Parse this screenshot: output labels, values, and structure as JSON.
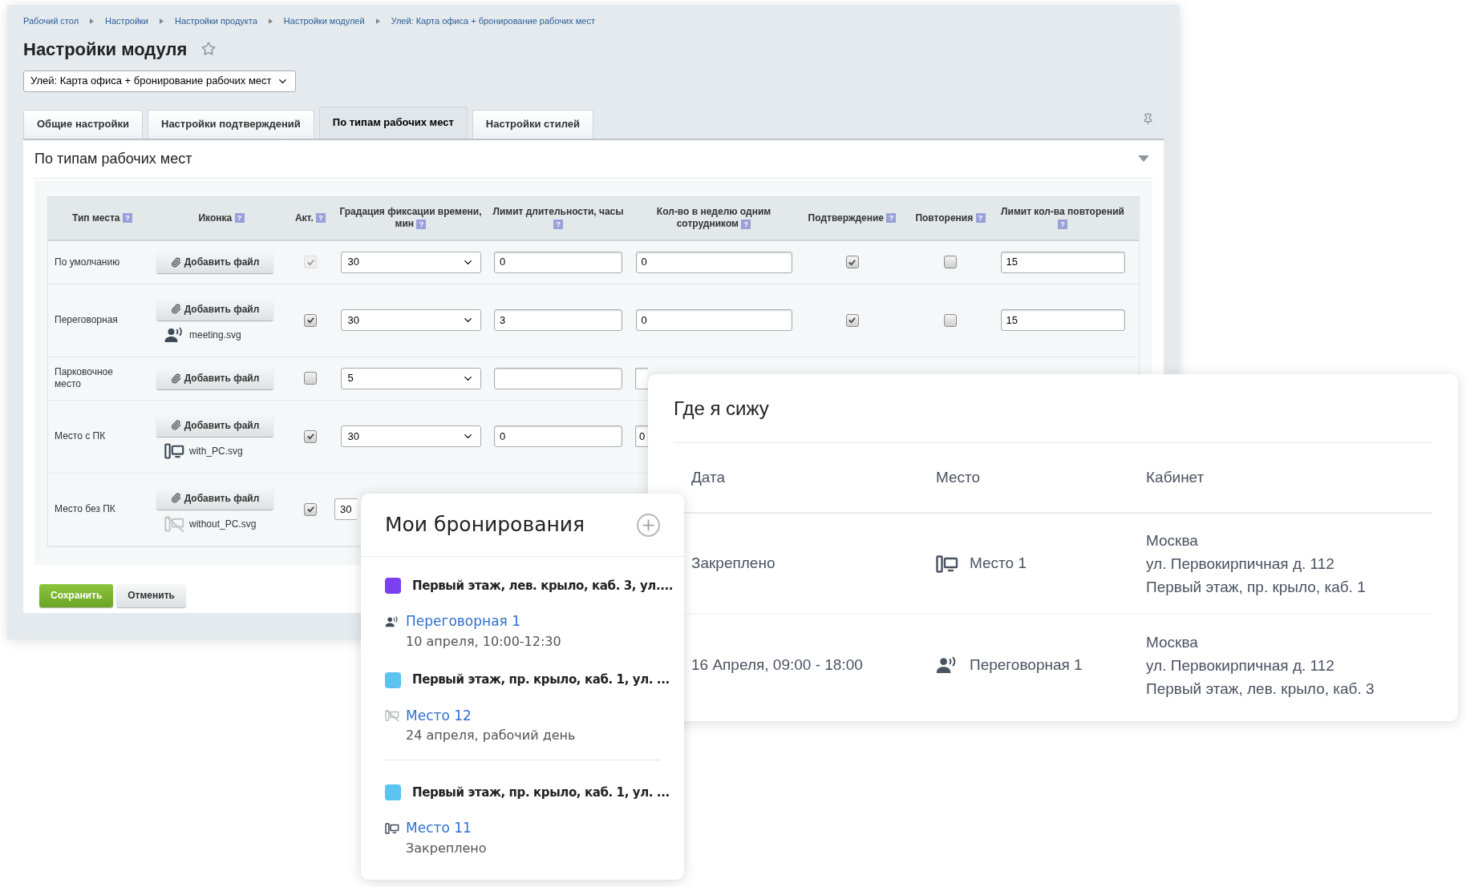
{
  "admin": {
    "breadcrumbs": [
      "Рабочий стол",
      "Настройки",
      "Настройки продукта",
      "Настройки модулей",
      "Улей: Карта офиса + бронирование рабочих мест"
    ],
    "title": "Настройки модуля",
    "module_select": {
      "value": "Улей: Карта офиса + бронирование рабочих мест"
    },
    "tabs": [
      {
        "label": "Общие настройки",
        "selected": false
      },
      {
        "label": "Настройки подтверждений",
        "selected": false
      },
      {
        "label": "По типам рабочих мест",
        "selected": true
      },
      {
        "label": "Настройки стилей",
        "selected": false
      }
    ],
    "section_title": "По типам рабочих мест",
    "columns": [
      {
        "label": "Тип места",
        "help": "?"
      },
      {
        "label": "Иконка",
        "help": "?"
      },
      {
        "label": "Акт.",
        "help": "?"
      },
      {
        "label": "Градация фиксации времени, мин",
        "help": "?"
      },
      {
        "label": "Лимит длительности, часы",
        "help": "?"
      },
      {
        "label": "Кол-во в неделю одним сотрудником",
        "help": "?"
      },
      {
        "label": "Подтверждение",
        "help": "?"
      },
      {
        "label": "Повторения",
        "help": "?"
      },
      {
        "label": "Лимит кол-ва повторений",
        "help": "?"
      }
    ],
    "rows": [
      {
        "type": "По умолчанию",
        "add_file": "Добавить файл",
        "active_checked": true,
        "active_disabled": true,
        "gradation": "30",
        "limit_hours": "0",
        "weekly": "0",
        "confirmation": true,
        "repeats": false,
        "repeat_limit": "15"
      },
      {
        "type": "Переговорная",
        "add_file": "Добавить файл",
        "file": {
          "name": "meeting.svg",
          "kind": "meeting"
        },
        "active_checked": true,
        "active_disabled": false,
        "gradation": "30",
        "limit_hours": "3",
        "weekly": "0",
        "confirmation": true,
        "repeats": false,
        "repeat_limit": "15"
      },
      {
        "type": "Парковочное место",
        "add_file": "Добавить файл",
        "active_checked": false,
        "active_disabled": false,
        "gradation": "5",
        "limit_hours": null,
        "weekly": null
      },
      {
        "type": "Место с ПК",
        "add_file": "Добавить файл",
        "file": {
          "name": "with_PC.svg",
          "kind": "pc"
        },
        "active_checked": true,
        "active_disabled": false,
        "gradation": "30",
        "limit_hours": "0",
        "weekly": "0"
      },
      {
        "type": "Место без ПК",
        "add_file": "Добавить файл",
        "file": {
          "name": "without_PC.svg",
          "kind": "no_pc"
        },
        "active_checked": true,
        "active_disabled": false,
        "gradation": "30"
      }
    ],
    "buttons": [
      {
        "label": "Сохранить",
        "kind": "primary"
      },
      {
        "label": "Отменить",
        "kind": "secondary"
      }
    ]
  },
  "where_i_sit": {
    "title": "Где я сижу",
    "columns": [
      "Дата",
      "Место",
      "Кабинет"
    ],
    "rows": [
      {
        "date": "Закреплено",
        "place": "Место 1",
        "kind": "pc",
        "office": [
          "Москва",
          "ул. Первокирпичная д. 112",
          "Первый этаж, пр. крыло, каб. 1"
        ]
      },
      {
        "date": "16 Апреля, 09:00 - 18:00",
        "place": "Переговорная 1",
        "kind": "meeting",
        "office": [
          "Москва",
          "ул. Первокирпичная д. 112",
          "Первый этаж, лев. крыло, каб. 3"
        ]
      }
    ]
  },
  "my_bookings": {
    "title": "Мои бронирования",
    "items": [
      {
        "address": "Первый этаж, лев. крыло, каб. 3, ул....",
        "color": "#7b3ff2",
        "place": "Переговорная 1",
        "kind": "meeting",
        "when": "10 апреля, 10:00-12:30",
        "divider_before": false
      },
      {
        "address": "Первый этаж, пр. крыло, каб. 1, ул. ...",
        "color": "#5bc3f0",
        "place": "Место 12",
        "kind": "no_pc",
        "when": "24 апреля, рабочий день",
        "divider_before": false
      },
      {
        "address": "Первый этаж, пр. крыло, каб. 1, ул. ...",
        "color": "#5bc3f0",
        "place": "Место 11",
        "kind": "pc",
        "when": "Закреплено",
        "divider_before": true
      }
    ]
  }
}
